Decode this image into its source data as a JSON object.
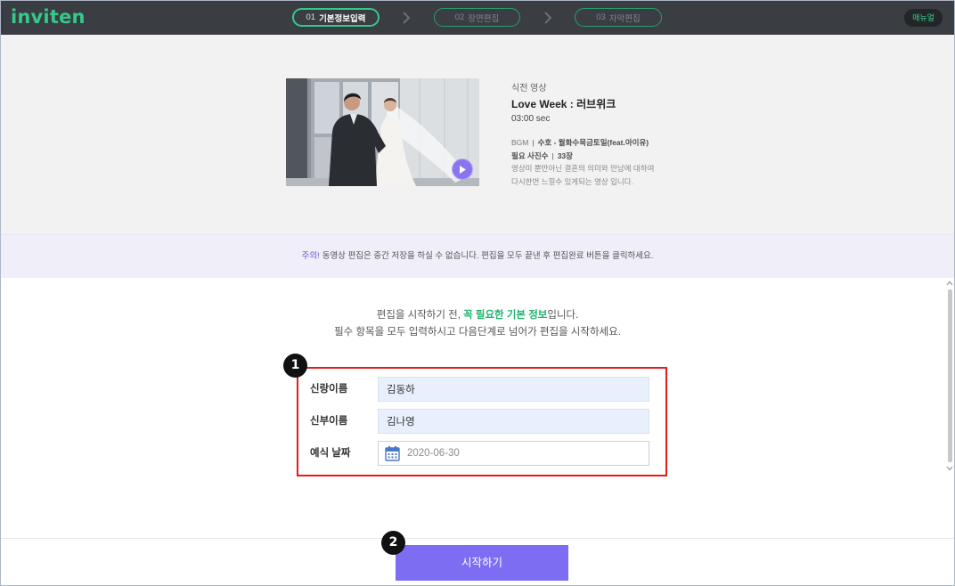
{
  "app": {
    "logo": "inviten"
  },
  "header": {
    "steps": [
      {
        "number": "01",
        "label": "기본정보입력",
        "active": true
      },
      {
        "number": "02",
        "label": "장면편집",
        "active": false
      },
      {
        "number": "03",
        "label": "자막편집",
        "active": false
      }
    ],
    "manual_label": "매뉴얼"
  },
  "video": {
    "category": "식전 영상",
    "title": "Love Week : 러브위크",
    "duration": "03:00 sec",
    "bgm_label": "BGM",
    "bgm_value": "수호 - 월화수목금토일(feat.아이유)",
    "photos_label": "필요 사진수",
    "photos_value": "33장",
    "separator": "|",
    "description": [
      "영상미 뿐만아닌 결혼의 의미와 만남에 대하여",
      "다시한번 느낄수 있게되는 영상 입니다."
    ]
  },
  "notice": {
    "prefix": "주의!",
    "text": "동영상 편집은 중간 저장을 하실 수 없습니다. 편집을 모두 끝낸 후 편집완료 버튼을 클릭하세요."
  },
  "intro": {
    "line1_prefix": "편집을 시작하기 전, ",
    "line1_highlight": "꼭 필요한 기본 정보",
    "line1_suffix": "입니다.",
    "line2": "필수 항목을 모두 입력하시고 다음단계로 넘어가 편집을 시작하세요."
  },
  "form": {
    "fields": [
      {
        "label": "신랑이름",
        "value": "김동하"
      },
      {
        "label": "신부이름",
        "value": "김나영"
      },
      {
        "label": "예식 날짜",
        "value": "2020-06-30"
      }
    ]
  },
  "start_button": {
    "label": "시작하기"
  },
  "annotations": {
    "marker_1": "1",
    "marker_2": "2"
  },
  "icons": {
    "step_separator": "chevron-right-icon",
    "play": "play-icon",
    "calendar": "calendar-icon",
    "scroll_up": "chevron-up-icon",
    "scroll_down": "chevron-down-icon"
  },
  "colors": {
    "brand": "#34c98a",
    "brand_dim": "#2a9e6c",
    "header_background": "#3a3d42",
    "primary_button": "#7c6df2",
    "notice_accent": "#6a5bd6",
    "highlight_text": "#1fb36d",
    "annotation_red": "#e31c1c",
    "input_autofill": "#e8f0fe"
  }
}
